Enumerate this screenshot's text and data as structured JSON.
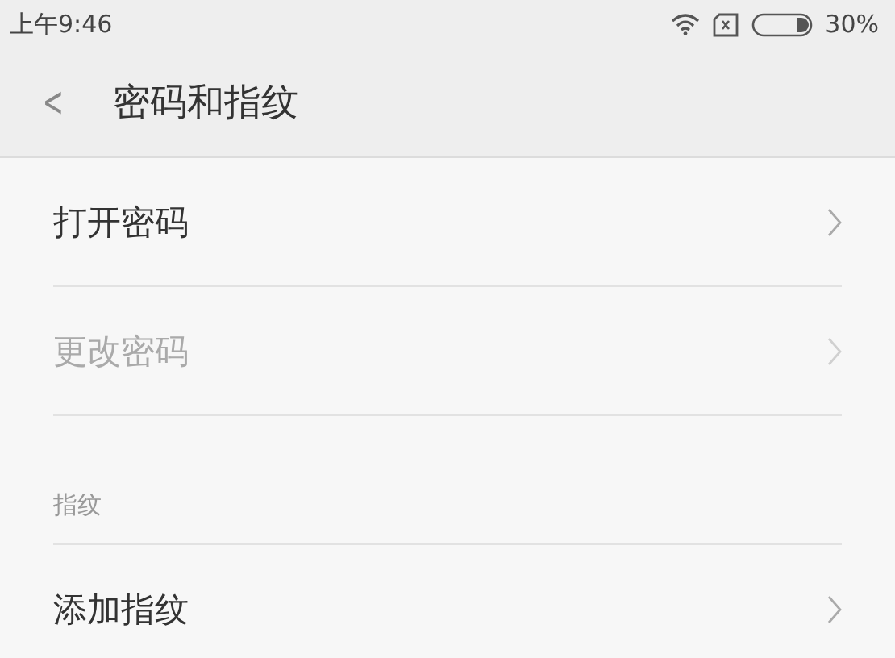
{
  "status_bar": {
    "time": "上午9:46",
    "battery_percent": "30%"
  },
  "header": {
    "back": "<",
    "title": "密码和指纹"
  },
  "items": [
    {
      "kind": "row",
      "label": "打开密码",
      "disabled": false
    },
    {
      "kind": "row",
      "label": "更改密码",
      "disabled": true
    },
    {
      "kind": "section",
      "label": "指纹"
    },
    {
      "kind": "row",
      "label": "添加指纹",
      "disabled": false
    }
  ]
}
